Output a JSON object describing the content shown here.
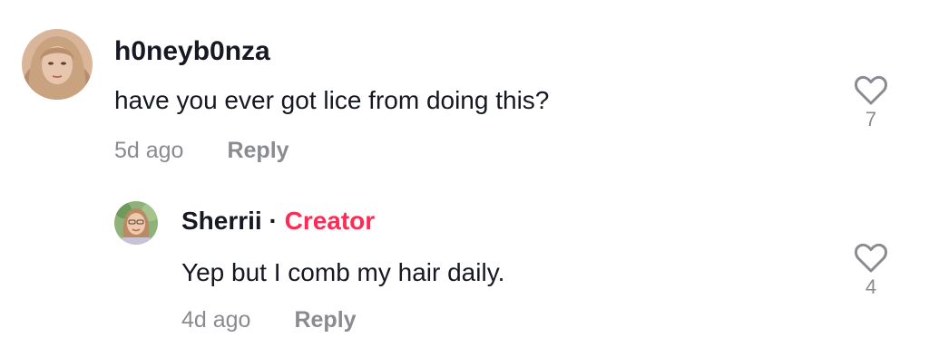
{
  "comments": [
    {
      "username": "h0neyb0nza",
      "text": "have you ever got lice from doing this?",
      "time": "5d ago",
      "reply_label": "Reply",
      "likes": "7",
      "avatar_icon": "user-avatar-girl"
    }
  ],
  "reply": {
    "username": "Sherrii",
    "separator": "·",
    "creator_badge": "Creator",
    "text": "Yep but I comb my hair daily.",
    "time": "4d ago",
    "reply_label": "Reply",
    "likes": "4",
    "avatar_icon": "user-avatar-woman"
  },
  "colors": {
    "creator": "#fe2c55",
    "muted": "#8a8b91",
    "text": "#161823"
  }
}
